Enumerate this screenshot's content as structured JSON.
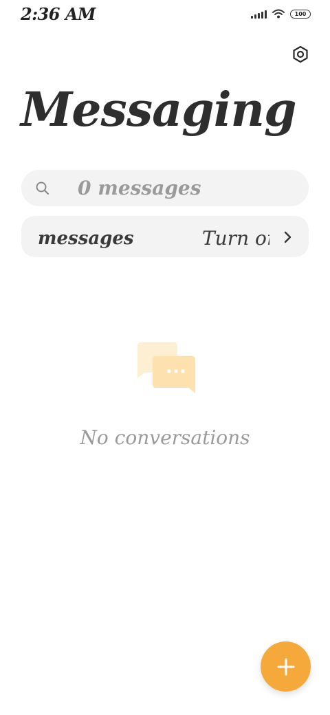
{
  "status_bar": {
    "time": "2:36 AM",
    "battery": "100",
    "icons": [
      "signal-icon",
      "wifi-icon",
      "battery-icon"
    ]
  },
  "header": {
    "title": "Messaging",
    "settings_icon": "settings-icon"
  },
  "search": {
    "placeholder": "0 messages"
  },
  "banner": {
    "text": "messages",
    "action": "Turn on",
    "chevron_icon": "chevron-right-icon"
  },
  "empty_state": {
    "icon": "chat-bubbles-icon",
    "text": "No conversations"
  },
  "fab": {
    "icon": "plus-icon"
  },
  "colors": {
    "accent": "#f6a93b",
    "surface": "#f3f3f3",
    "muted_text": "#9a9a9a"
  }
}
